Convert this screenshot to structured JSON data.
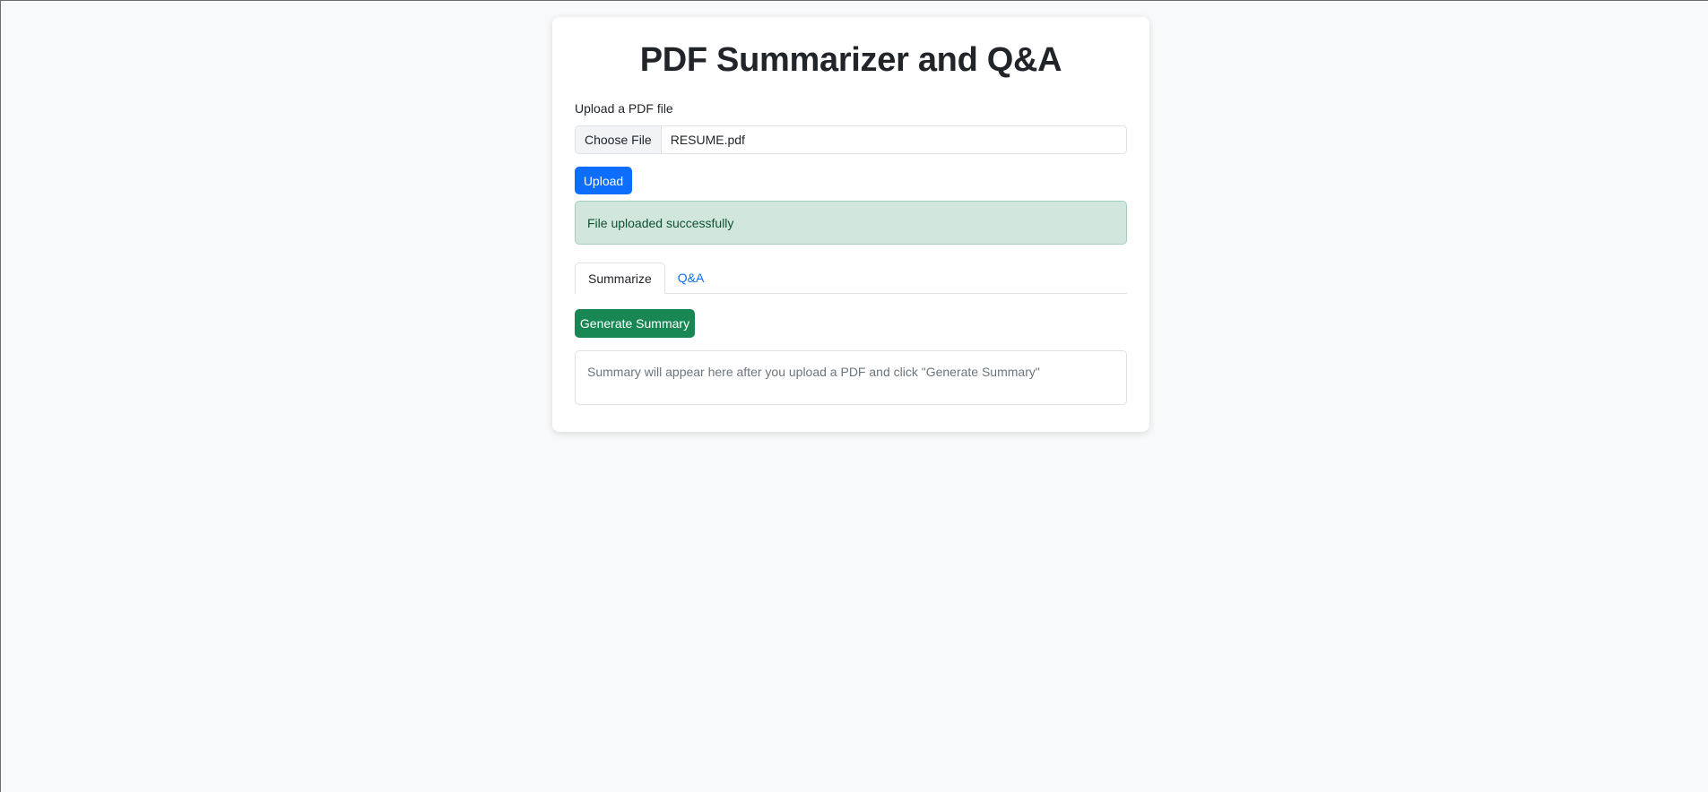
{
  "page": {
    "title": "PDF Summarizer and Q&A"
  },
  "upload": {
    "label": "Upload a PDF file",
    "choose_file_label": "Choose File",
    "file_name": "RESUME.pdf",
    "button_label": "Upload"
  },
  "alert": {
    "message": "File uploaded successfully",
    "status_color": "#d1e7dd"
  },
  "tabs": [
    {
      "label": "Summarize",
      "active": true
    },
    {
      "label": "Q&A",
      "active": false
    }
  ],
  "summary": {
    "button_label": "Generate Summary",
    "placeholder_text": "Summary will appear here after you upload a PDF and click \"Generate Summary\""
  },
  "colors": {
    "primary": "#0d6efd",
    "success": "#198754",
    "background": "#f8f9fa"
  }
}
